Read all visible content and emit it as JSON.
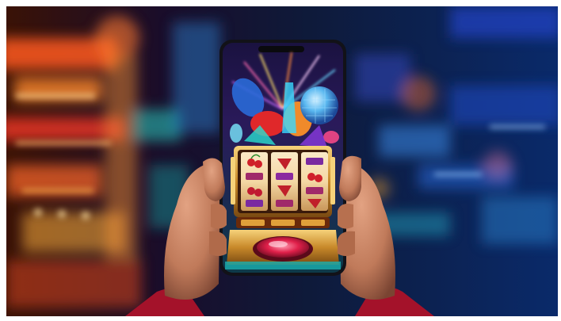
{
  "scene": {
    "background_color": "#ffffff",
    "left_glow_color": "#ff5a1f",
    "right_glow_color": "#1f6bff",
    "phone_color": "#121218",
    "hand_color": "#c98463",
    "sleeve_color": "#a4122a",
    "reel_symbol_icons": [
      "cherry-icon",
      "bar-icon",
      "seven-icon"
    ]
  }
}
